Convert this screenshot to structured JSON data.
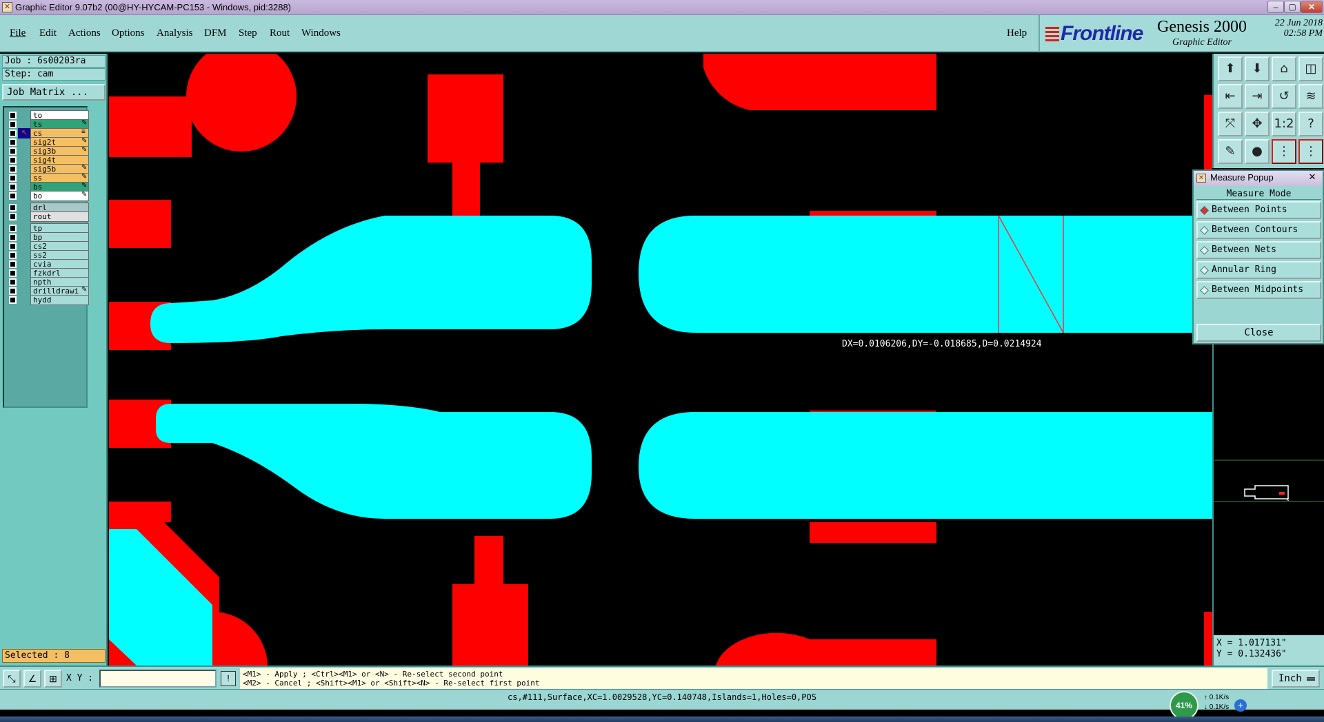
{
  "window": {
    "title": "Graphic Editor 9.07b2 (00@HY-HYCAM-PC153 - Windows, pid:3288)"
  },
  "menu": {
    "items": [
      "File",
      "Edit",
      "Actions",
      "Options",
      "Analysis",
      "DFM",
      "Step",
      "Rout",
      "Windows"
    ],
    "help": "Help"
  },
  "brand": {
    "logo": "Frontline",
    "product": "Genesis 2000",
    "subtitle": "Graphic Editor",
    "date": "22 Jun 2018",
    "time": "02:58 PM"
  },
  "job": {
    "job_line": "Job : 6s00203ra",
    "step_line": "Step: cam",
    "matrix_button": "Job Matrix ..."
  },
  "layers": [
    {
      "name": "to",
      "color": "#ffffff",
      "flag": ""
    },
    {
      "name": "ts",
      "color": "#2fa37a",
      "flag": "✎"
    },
    {
      "name": "cs",
      "color": "#f4bf62",
      "flag": "≡",
      "active": true
    },
    {
      "name": "sig2t",
      "color": "#f4bf62",
      "flag": "✎"
    },
    {
      "name": "sig3b",
      "color": "#f4bf62",
      "flag": "✎"
    },
    {
      "name": "sig4t",
      "color": "#f4bf62",
      "flag": ""
    },
    {
      "name": "sig5b",
      "color": "#f4bf62",
      "flag": "✎"
    },
    {
      "name": "ss",
      "color": "#f4bf62",
      "flag": "✎"
    },
    {
      "name": "bs",
      "color": "#2fa37a",
      "flag": "✎"
    },
    {
      "name": "bo",
      "color": "#ffffff",
      "flag": "✎"
    },
    {
      "name": "drl",
      "color": "#a9c8c8",
      "flag": ""
    },
    {
      "name": "rout",
      "color": "#e0e0e0",
      "flag": ""
    },
    {
      "name": "tp",
      "color": "#a7dcd8",
      "flag": ""
    },
    {
      "name": "bp",
      "color": "#a7dcd8",
      "flag": ""
    },
    {
      "name": "cs2",
      "color": "#a7dcd8",
      "flag": ""
    },
    {
      "name": "ss2",
      "color": "#a7dcd8",
      "flag": ""
    },
    {
      "name": "cvia",
      "color": "#a7dcd8",
      "flag": ""
    },
    {
      "name": "fzkdrl",
      "color": "#a7dcd8",
      "flag": ""
    },
    {
      "name": "npth",
      "color": "#a7dcd8",
      "flag": ""
    },
    {
      "name": "drilldrawi",
      "color": "#a7dcd8",
      "flag": "✎"
    },
    {
      "name": "hydd",
      "color": "#a7dcd8",
      "flag": ""
    }
  ],
  "selected": "Selected : 8",
  "measure": {
    "readout": "DX=0.0106206,DY=-0.018685,D=0.0214924"
  },
  "right_tools": [
    "⬆",
    "⬇",
    "⌂",
    "◫",
    "⇤",
    "⇥",
    "↺",
    "≋",
    "⤧",
    "✥",
    "1:2",
    "?",
    "✎",
    "●",
    "⋮",
    "⋮"
  ],
  "popup": {
    "title": "Measure Popup",
    "close_x": "✕",
    "heading": "Measure Mode",
    "options": [
      {
        "label": "Between Points",
        "selected": true
      },
      {
        "label": "Between Contours",
        "selected": false
      },
      {
        "label": "Between Nets",
        "selected": false
      },
      {
        "label": "Annular Ring",
        "selected": false
      },
      {
        "label": "Between Midpoints",
        "selected": false
      }
    ],
    "close_button": "Close"
  },
  "coords": {
    "x": "X = 1.017131\"",
    "y": "Y = 0.132436\""
  },
  "bottom": {
    "xy_label": "X Y :",
    "xy_value": "",
    "hint_line1": "<M1> - Apply  ; <Ctrl><M1> or <N> - Re-select second point",
    "hint_line2": "<M2> - Cancel ; <Shift><M1> or <Shift><N> - Re-select first point",
    "units": "Inch"
  },
  "status": {
    "feature_info": "cs,#111,Surface,XC=1.0029528,YC=0.140748,Islands=1,Holes=0,POS"
  },
  "network": {
    "percent": "41%",
    "up": "0.1K/s",
    "down": "0.1K/s"
  },
  "colors": {
    "copper": "#ff0000",
    "highlight": "#00ffff",
    "panel": "#9bd6d2"
  }
}
